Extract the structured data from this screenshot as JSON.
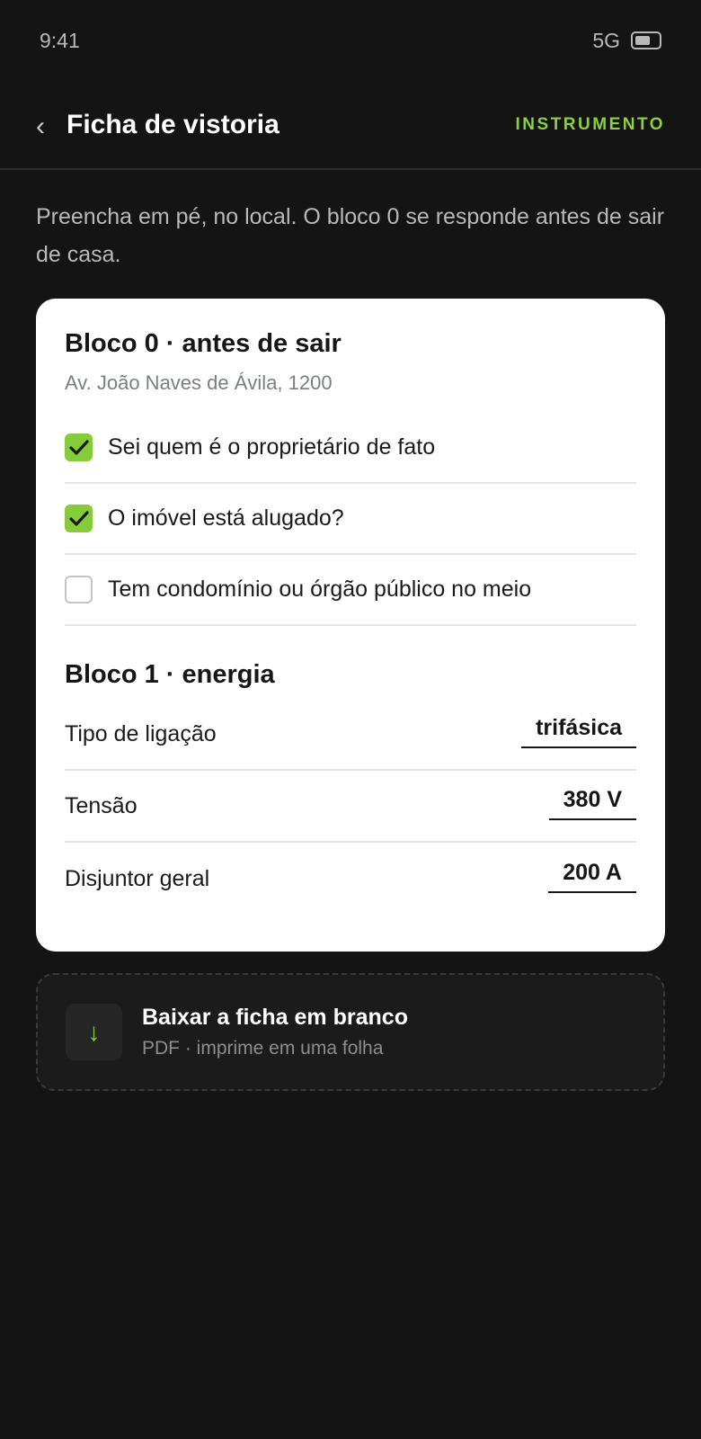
{
  "status": {
    "time": "9:41",
    "network": "5G"
  },
  "header": {
    "back_icon": "‹",
    "title": "Ficha de vistoria",
    "tag": "INSTRUMENTO",
    "tag_color": "#8ccf3f"
  },
  "intro": "Preencha em pé, no local. O bloco 0 se responde antes de sair de casa.",
  "block0": {
    "title": "Bloco 0 · antes de sair",
    "address": "Av. João Naves de Ávila, 1200",
    "items": [
      {
        "label": "Sei quem é o proprietário de fato",
        "checked": true
      },
      {
        "label": "O imóvel está alugado?",
        "checked": true
      },
      {
        "label": "Tem condomínio ou órgão público no meio",
        "checked": false
      }
    ]
  },
  "block1": {
    "title": "Bloco 1 · energia",
    "fields": [
      {
        "label": "Tipo de ligação",
        "value": "trifásica"
      },
      {
        "label": "Tensão",
        "value": "380 V"
      },
      {
        "label": "Disjuntor geral",
        "value": "200 A"
      }
    ]
  },
  "download": {
    "icon": "↓",
    "title": "Baixar a ficha em branco",
    "subtitle": "PDF · imprime em uma folha"
  },
  "colors": {
    "accent": "#86cc3a",
    "background": "#141414",
    "card": "#ffffff"
  }
}
